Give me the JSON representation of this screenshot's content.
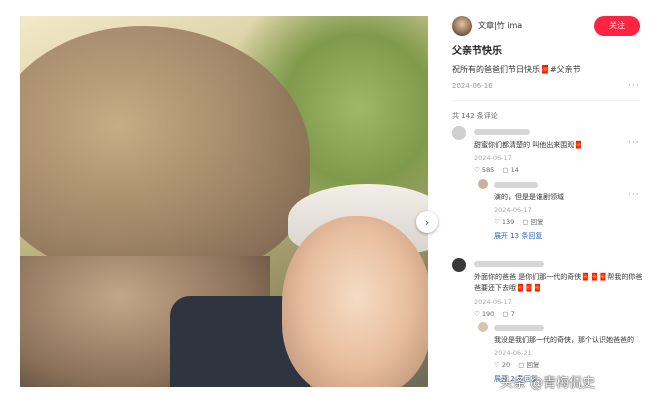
{
  "post": {
    "author": "文章|竹 ima",
    "follow_label": "关注",
    "title": "父亲节快乐",
    "body": "祝所有的爸爸们节日快乐🧧#父亲节",
    "date": "2024-06-16",
    "more": "···"
  },
  "comments_count": "共 142 条评论",
  "comments": [
    {
      "text": "甜蜜你们都清楚的 叫他出来围观🧧",
      "date": "2024-06-17",
      "likes": "585",
      "replies": "14",
      "reply": {
        "text": "演的，但是是谁剧领域",
        "date": "2024-06-17",
        "likes": "139",
        "replies": "回复",
        "expand": "展开 13 条回复"
      }
    },
    {
      "text_line1": "外面你的爸爸 是你们那一代的奇侠🧧🧧🧧帮我的你爸",
      "text_line2": "爸要还下去哦🧧🧧🧧",
      "date": "2024-06-17",
      "likes": "190",
      "replies": "7",
      "reply": {
        "text": "我没是我们那一代的奇侠，那个认识她爸爸的",
        "date": "2024-06-21",
        "likes": "20",
        "replies": "回复",
        "expand": "展开 2 条回复"
      }
    }
  ],
  "watermark": "头条 @青梅侃史"
}
